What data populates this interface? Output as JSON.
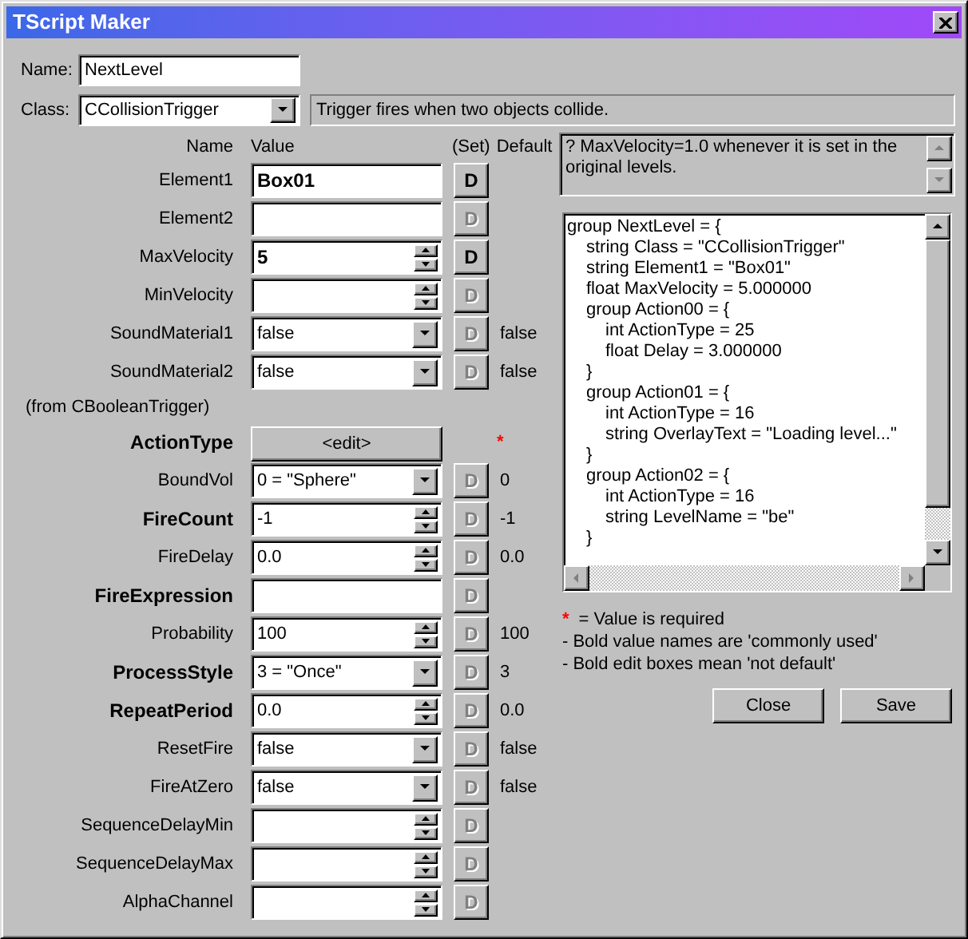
{
  "window": {
    "title": "TScript Maker"
  },
  "name_field": {
    "label": "Name:",
    "value": "NextLevel"
  },
  "class_field": {
    "label": "Class:",
    "value": "CCollisionTrigger",
    "description": "Trigger fires when two objects collide."
  },
  "columns": [
    "Name",
    "Value",
    "(Set)",
    "Default"
  ],
  "properties": [
    {
      "kind": "text",
      "name": "Element1",
      "bold_name": false,
      "value": "Box01",
      "bold_value": true,
      "set_label": "D",
      "set_enabled": true
    },
    {
      "kind": "text",
      "name": "Element2",
      "bold_name": false,
      "set_label": "D",
      "set_enabled": false
    },
    {
      "kind": "spin",
      "name": "MaxVelocity",
      "bold_name": false,
      "value": "5",
      "bold_value": true,
      "set_label": "D",
      "set_enabled": true
    },
    {
      "kind": "spin",
      "name": "MinVelocity",
      "bold_name": false,
      "set_label": "D",
      "set_enabled": false
    },
    {
      "kind": "combo",
      "name": "SoundMaterial1",
      "bold_name": false,
      "value": "false",
      "bold_value": false,
      "set_label": "D",
      "set_enabled": false,
      "default": "false"
    },
    {
      "kind": "combo",
      "name": "SoundMaterial2",
      "bold_name": false,
      "value": "false",
      "bold_value": false,
      "set_label": "D",
      "set_enabled": false,
      "default": "false"
    },
    {
      "kind": "section",
      "name": "(from CBooleanTrigger)"
    },
    {
      "kind": "button",
      "name": "ActionType",
      "bold_name": true,
      "value": "<edit>",
      "required": "*"
    },
    {
      "kind": "combo",
      "name": "BoundVol",
      "bold_name": false,
      "value": "0 = \"Sphere\"",
      "bold_value": false,
      "set_label": "D",
      "set_enabled": false,
      "default": "0"
    },
    {
      "kind": "spin",
      "name": "FireCount",
      "bold_name": true,
      "value": "-1",
      "bold_value": false,
      "set_label": "D",
      "set_enabled": false,
      "default": "-1"
    },
    {
      "kind": "spin",
      "name": "FireDelay",
      "bold_name": false,
      "value": "0.0",
      "bold_value": false,
      "set_label": "D",
      "set_enabled": false,
      "default": "0.0"
    },
    {
      "kind": "text",
      "name": "FireExpression",
      "bold_name": true,
      "set_label": "D",
      "set_enabled": false
    },
    {
      "kind": "spin",
      "name": "Probability",
      "bold_name": false,
      "value": "100",
      "bold_value": false,
      "set_label": "D",
      "set_enabled": false,
      "default": "100"
    },
    {
      "kind": "combo",
      "name": "ProcessStyle",
      "bold_name": true,
      "value": "3 = \"Once\"",
      "bold_value": false,
      "set_label": "D",
      "set_enabled": false,
      "default": "3"
    },
    {
      "kind": "spin",
      "name": "RepeatPeriod",
      "bold_name": true,
      "value": "0.0",
      "bold_value": false,
      "set_label": "D",
      "set_enabled": false,
      "default": "0.0"
    },
    {
      "kind": "combo",
      "name": "ResetFire",
      "bold_name": false,
      "value": "false",
      "bold_value": false,
      "set_label": "D",
      "set_enabled": false,
      "default": "false"
    },
    {
      "kind": "combo",
      "name": "FireAtZero",
      "bold_name": false,
      "value": "false",
      "bold_value": false,
      "set_label": "D",
      "set_enabled": false,
      "default": "false"
    },
    {
      "kind": "spin",
      "name": "SequenceDelayMin",
      "bold_name": false,
      "set_label": "D",
      "set_enabled": false
    },
    {
      "kind": "spin",
      "name": "SequenceDelayMax",
      "bold_name": false,
      "set_label": "D",
      "set_enabled": false
    },
    {
      "kind": "spin",
      "name": "AlphaChannel",
      "bold_name": false,
      "set_label": "D",
      "set_enabled": false
    }
  ],
  "hint": "? MaxVelocity=1.0 whenever it is set in the original levels.",
  "script": [
    {
      "text": "group NextLevel = {",
      "children": [
        {
          "text": "string Class = \"CCollisionTrigger\""
        },
        {
          "text": "string Element1 = \"Box01\""
        },
        {
          "text": "float MaxVelocity = 5.000000"
        },
        {
          "text": "group Action00 = {",
          "children": [
            {
              "text": "int ActionType = 25"
            },
            {
              "text": "float Delay = 3.000000"
            }
          ]
        },
        {
          "text": "}"
        },
        {
          "text": "group Action01 = {",
          "children": [
            {
              "text": "int ActionType = 16"
            },
            {
              "text": "string OverlayText = \"Loading level...\""
            }
          ]
        },
        {
          "text": "}"
        },
        {
          "text": "group Action02 = {",
          "children": [
            {
              "text": "int ActionType = 16"
            },
            {
              "text": "string LevelName = \"be\""
            }
          ]
        },
        {
          "text": "}"
        }
      ]
    }
  ],
  "legend": {
    "mark": "*",
    "mark_text": "= Value is required",
    "notes": [
      "- Bold value names are 'commonly used'",
      "- Bold edit boxes mean 'not default'"
    ]
  },
  "buttons": [
    "Close",
    "Save"
  ]
}
